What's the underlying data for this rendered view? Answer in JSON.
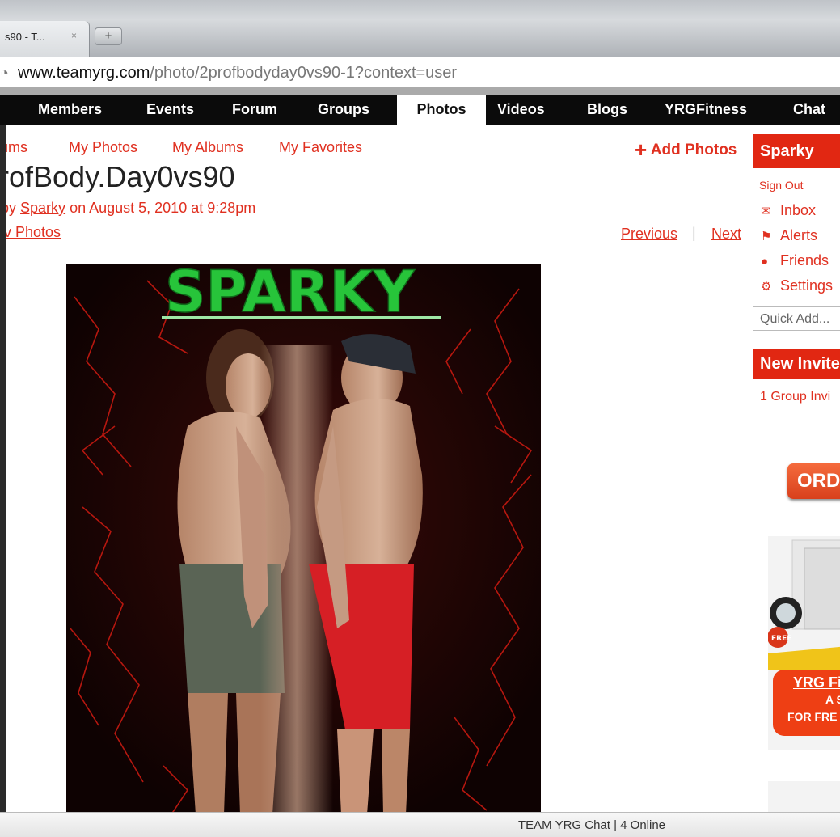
{
  "browser": {
    "tab_title": "s90 - T...",
    "tab_close": "×",
    "new_tab": "+",
    "url_host": "www.teamyrg.com",
    "url_path": "/photo/2profbodyday0vs90-1?context=user"
  },
  "nav": {
    "items": [
      "Members",
      "Events",
      "Forum",
      "Groups",
      "Photos",
      "Videos",
      "Blogs",
      "YRGFitness",
      "Chat"
    ],
    "active": "Photos"
  },
  "subnav": {
    "items": [
      "ums",
      "My Photos",
      "My Albums",
      "My Favorites"
    ],
    "add_photos": "Add Photos"
  },
  "photo": {
    "title": "rofBody.Day0vs90",
    "by": "by",
    "author": "Sparky",
    "date_text": "on August 5, 2010 at 9:28pm",
    "view_photos": "v Photos",
    "previous": "Previous",
    "separator": "|",
    "next": "Next",
    "image_text": "SPARKY"
  },
  "sidebar": {
    "username": "Sparky",
    "sign_out": "Sign Out",
    "items": [
      "Inbox",
      "Alerts",
      "Friends",
      "Settings"
    ],
    "quick_add_placeholder": "Quick Add...",
    "invites_heading": "New Invite",
    "invites_text": "1 Group Invi",
    "order_label": "ORDI",
    "ad_line1": "YRG Fi",
    "ad_line2": "A S",
    "ad_line3": "FOR FRE",
    "ad_badge": "FREE"
  },
  "footer": {
    "chat_status": "TEAM YRG Chat | 4 Online"
  },
  "colors": {
    "accent": "#e12712",
    "link": "#e03020",
    "nav_bg": "#0b0b0b",
    "sparky_green": "#27c43a"
  }
}
